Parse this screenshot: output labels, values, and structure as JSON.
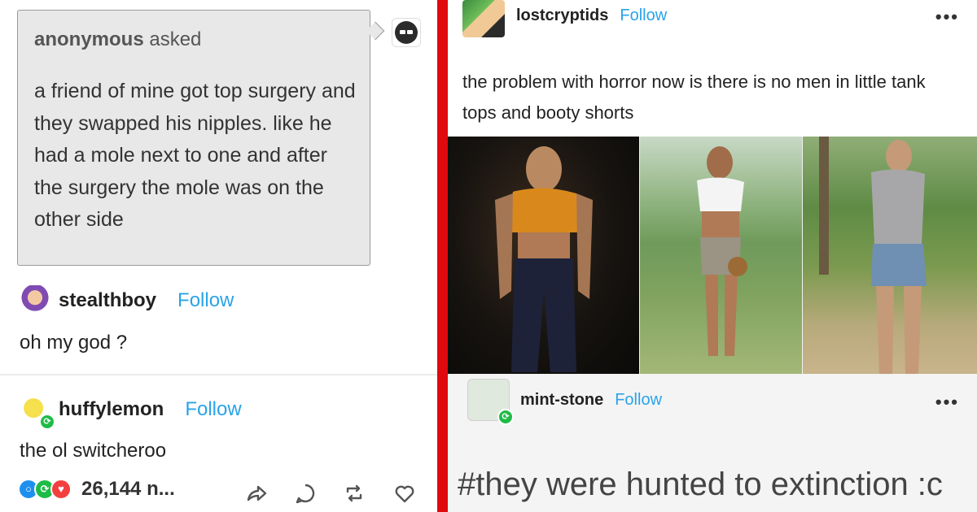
{
  "left_post": {
    "ask": {
      "asker": "anonymous",
      "asked_label": "asked",
      "body": "a friend of mine got top surgery and they swapped his nipples. like he had a mole next to one and after the surgery the mole was on the other side"
    },
    "reblogs": [
      {
        "username": "stealthboy",
        "follow_label": "Follow",
        "text": "oh my god ?"
      },
      {
        "username": "huffylemon",
        "follow_label": "Follow",
        "text": "the ol switcheroo"
      }
    ],
    "footer": {
      "notes_count": "26,144 n...",
      "icons": [
        "share-icon",
        "reply-icon",
        "reblog-icon",
        "like-icon"
      ]
    }
  },
  "right_post": {
    "op": {
      "username": "lostcryptids",
      "follow_label": "Follow",
      "more_label": "•••",
      "text": "the problem with horror now is there is no men in little tank tops and booty shorts"
    },
    "reblog": {
      "username": "mint-stone",
      "follow_label": "Follow",
      "more_label": "•••",
      "tag": "#they were hunted to extinction :c"
    }
  },
  "colors": {
    "divider": "#e0090e",
    "follow": "#2aa3e8",
    "reblog_green": "#1fbb47",
    "notes_blue": "#1f8fef",
    "notes_red": "#f43f3f"
  }
}
